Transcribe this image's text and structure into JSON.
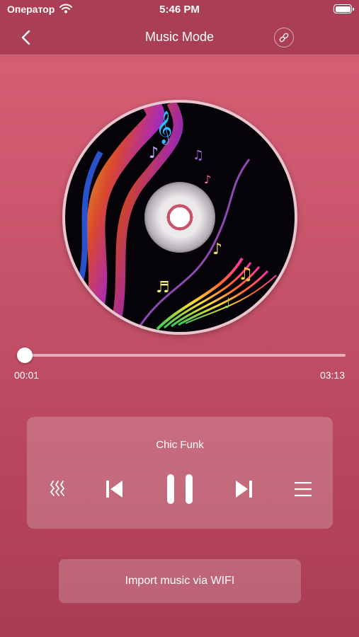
{
  "status_bar": {
    "carrier": "Оператор",
    "time": "5:46 PM",
    "icons": [
      "wifi-icon",
      "battery-icon"
    ]
  },
  "nav": {
    "title": "Music Mode",
    "back_icon": "chevron-left-icon",
    "action_icon": "link-icon"
  },
  "album_art": {
    "icon": "music-disc-art"
  },
  "player": {
    "current_time": "00:01",
    "total_time": "03:13",
    "progress": 0.005,
    "song_title": "Chic Funk",
    "controls": [
      "play-mode-icon",
      "previous-icon",
      "pause-icon",
      "next-icon",
      "playlist-icon"
    ]
  },
  "import_button": {
    "label": "Import music via WIFI"
  },
  "colors": {
    "background": "#c8546b",
    "bar": "#a93e54",
    "text": "#ffffff"
  }
}
